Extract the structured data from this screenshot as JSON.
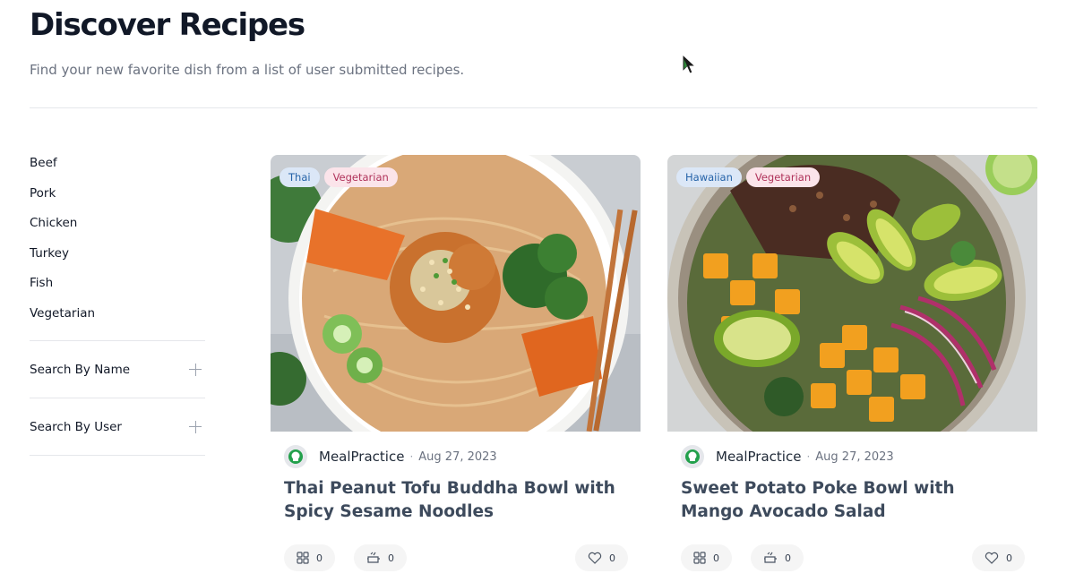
{
  "header": {
    "title": "Discover Recipes",
    "subtitle": "Find your new favorite dish from a list of user submitted recipes."
  },
  "sidebar": {
    "categories": [
      "Beef",
      "Pork",
      "Chicken",
      "Turkey",
      "Fish",
      "Vegetarian"
    ],
    "filters": [
      {
        "label": "Search By Name",
        "icon": "plus-icon"
      },
      {
        "label": "Search By User",
        "icon": "plus-icon"
      }
    ]
  },
  "recipes": [
    {
      "title": "Thai Peanut Tofu Buddha Bowl with Spicy Sesame Noodles",
      "tags": [
        "Thai",
        "Vegetarian"
      ],
      "author": "MealPractice",
      "date": "Aug 27, 2023",
      "saves": "0",
      "cooks": "0",
      "likes": "0"
    },
    {
      "title": "Sweet Potato Poke Bowl with Mango Avocado Salad",
      "tags": [
        "Hawaiian",
        "Vegetarian"
      ],
      "author": "MealPractice",
      "date": "Aug 27, 2023",
      "saves": "0",
      "cooks": "0",
      "likes": "0"
    }
  ],
  "colors": {
    "tag_region_bg": "#dbe7f7",
    "tag_region_text": "#2563a8",
    "tag_diet_bg": "#fbe4ea",
    "tag_diet_text": "#b0325a",
    "avatar_accent": "#22a04b"
  }
}
